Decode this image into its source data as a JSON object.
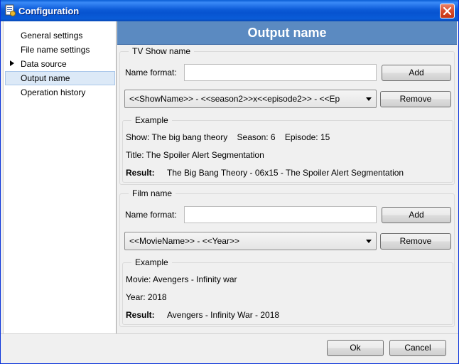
{
  "window": {
    "title": "Configuration"
  },
  "sidebar": {
    "items": [
      {
        "label": "General settings",
        "has_arrow": false
      },
      {
        "label": "File name settings",
        "has_arrow": false
      },
      {
        "label": "Data source",
        "has_arrow": true
      },
      {
        "label": "Output name",
        "has_arrow": false,
        "selected": true
      },
      {
        "label": "Operation history",
        "has_arrow": false
      }
    ]
  },
  "main": {
    "header_title": "Output name",
    "tv_show": {
      "legend": "TV Show name",
      "name_format_label": "Name format:",
      "name_format_value": "",
      "add_label": "Add",
      "format_selected": "<<ShowName>> - <<season2>>x<<episode2>> - <<Ep",
      "remove_label": "Remove",
      "example": {
        "legend": "Example",
        "show_line": "Show: The big bang theory    Season: 6    Episode: 15",
        "title_line": "Title: The Spoiler Alert Segmentation",
        "result_label": "Result:",
        "result_value": "The Big Bang Theory - 06x15 - The Spoiler Alert Segmentation"
      }
    },
    "film": {
      "legend": "Film name",
      "name_format_label": "Name format:",
      "name_format_value": "",
      "add_label": "Add",
      "format_selected": "<<MovieName>> - <<Year>>",
      "remove_label": "Remove",
      "example": {
        "legend": "Example",
        "movie_line": "Movie: Avengers - Infinity war",
        "year_line": "Year: 2018",
        "result_label": "Result:",
        "result_value": "Avengers - Infinity War - 2018"
      }
    }
  },
  "footer": {
    "ok_label": "Ok",
    "cancel_label": "Cancel"
  },
  "colors": {
    "titlebar": "#0A5CD8",
    "header": "#5B8AC1",
    "selection": "#DCE9F7"
  }
}
